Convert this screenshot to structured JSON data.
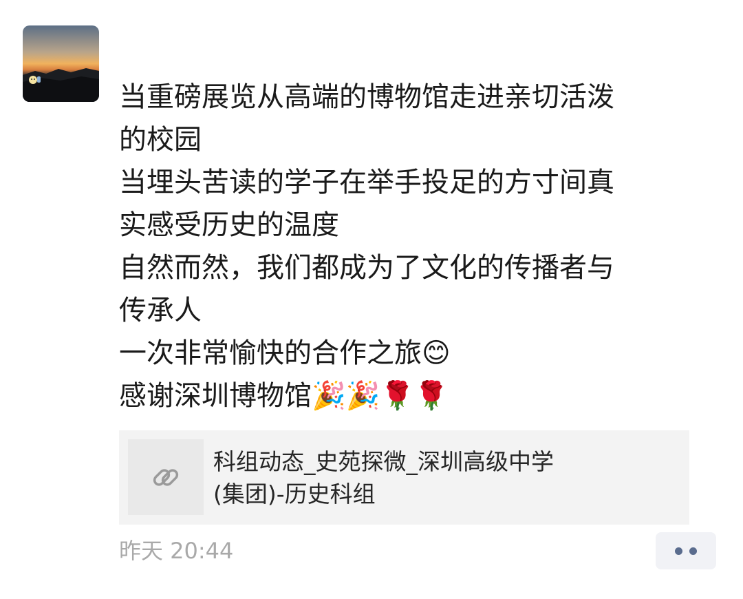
{
  "post": {
    "lines": [
      "当重磅展览从高端的博物馆走进亲切活泼",
      "的校园",
      "当埋头苦读的学子在举手投足的方寸间真",
      "实感受历史的温度",
      "自然而然，我们都成为了文化的传播者与",
      "传承人",
      "一次非常愉快的合作之旅😊",
      "感谢深圳博物馆🎉🎉🌹🌹"
    ]
  },
  "link_card": {
    "icon": "link-icon",
    "title_line1": "科组动态_史苑探微_深圳高级中学",
    "title_line2": "(集团)-历史科组"
  },
  "meta": {
    "timestamp": "昨天 20:44",
    "more_icon": "more-dots-icon"
  },
  "colors": {
    "text": "#1a1a1a",
    "timestamp": "#a9a9a9",
    "card_background": "#f3f3f3",
    "more_dots": "#5a6c8e"
  }
}
